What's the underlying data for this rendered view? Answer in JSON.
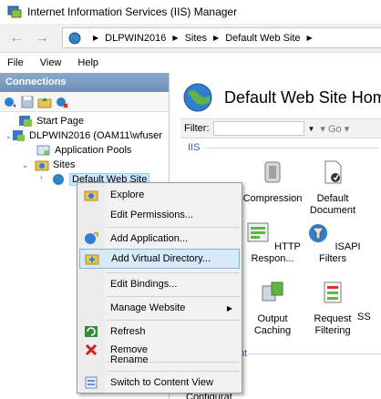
{
  "window": {
    "title": "Internet Information Services (IIS) Manager"
  },
  "address": {
    "crumbs": [
      "DLPWIN2016",
      "Sites",
      "Default Web Site"
    ]
  },
  "menu": {
    "file": "File",
    "view": "View",
    "help": "Help"
  },
  "connections": {
    "header": "Connections",
    "tree": {
      "start_page": "Start Page",
      "server": "DLPWIN2016 (OAM11\\wfuser",
      "app_pools": "Application Pools",
      "sites": "Sites",
      "default_site": "Default Web Site"
    }
  },
  "main": {
    "title": "Default Web Site Home",
    "filter_label": "Filter:",
    "go_label": "Go",
    "group_iis": "IIS",
    "group_management": "nt",
    "features": {
      "compression": "Compression",
      "default_document": "Default Document",
      "http_response": "HTTP Respon...",
      "isapi_filters": "ISAPI Filters",
      "output_caching": "Output Caching",
      "request_filtering": "Request Filtering",
      "ss": "SS",
      "configuration": "Configurat"
    }
  },
  "context_menu": {
    "explore": "Explore",
    "edit_permissions": "Edit Permissions...",
    "add_application": "Add Application...",
    "add_virtual_directory": "Add Virtual Directory...",
    "edit_bindings": "Edit Bindings...",
    "manage_website": "Manage Website",
    "refresh": "Refresh",
    "remove": "Remove",
    "rename": "Rename",
    "switch_to_content_view": "Switch to Content View"
  },
  "colors": {
    "highlight": "#d8eaf9",
    "highlight_border": "#7eb4ea",
    "header": "#7a98c0",
    "group_text": "#3a5ea8"
  }
}
